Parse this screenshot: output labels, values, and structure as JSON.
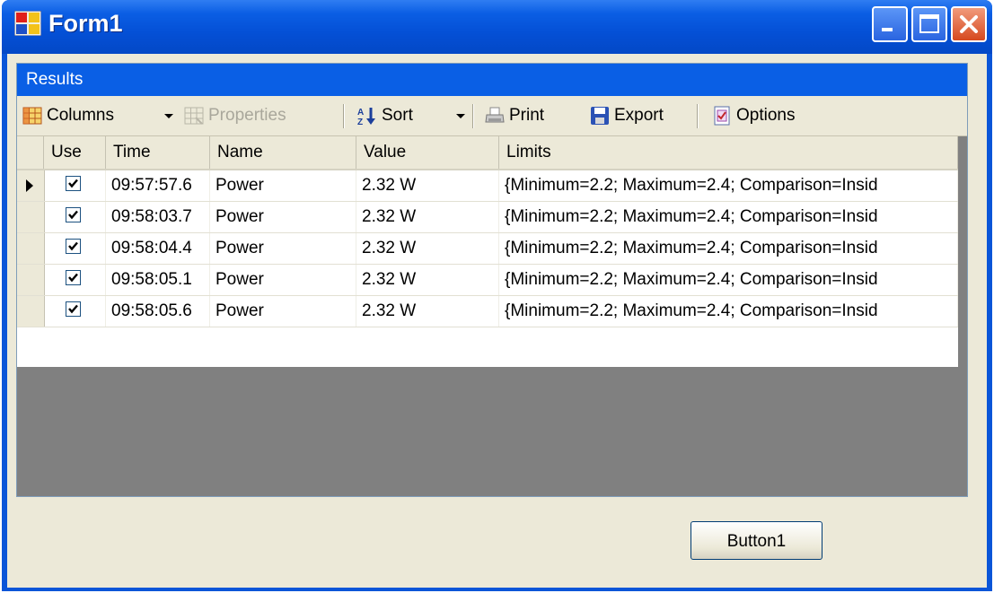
{
  "window": {
    "title": "Form1",
    "title_icon": "form-app-icon"
  },
  "titlebar_buttons": {
    "minimize": "minimize-icon",
    "maximize": "maximize-icon",
    "close": "close-icon"
  },
  "panel": {
    "header": "Results"
  },
  "toolbar": {
    "columns_label": "Columns",
    "properties_label": "Properties",
    "sort_label": "Sort",
    "print_label": "Print",
    "export_label": "Export",
    "options_label": "Options"
  },
  "grid": {
    "columns": [
      "Use",
      "Time",
      "Name",
      "Value",
      "Limits"
    ],
    "rows": [
      {
        "use": true,
        "time": "09:57:57.6",
        "name": "Power",
        "value": "2.32 W",
        "limits": "{Minimum=2.2; Maximum=2.4; Comparison=Insid",
        "current": true
      },
      {
        "use": true,
        "time": "09:58:03.7",
        "name": "Power",
        "value": "2.32 W",
        "limits": "{Minimum=2.2; Maximum=2.4; Comparison=Insid",
        "current": false
      },
      {
        "use": true,
        "time": "09:58:04.4",
        "name": "Power",
        "value": "2.32 W",
        "limits": "{Minimum=2.2; Maximum=2.4; Comparison=Insid",
        "current": false
      },
      {
        "use": true,
        "time": "09:58:05.1",
        "name": "Power",
        "value": "2.32 W",
        "limits": "{Minimum=2.2; Maximum=2.4; Comparison=Insid",
        "current": false
      },
      {
        "use": true,
        "time": "09:58:05.6",
        "name": "Power",
        "value": "2.32 W",
        "limits": "{Minimum=2.2; Maximum=2.4; Comparison=Insid",
        "current": false
      }
    ]
  },
  "button1_label": "Button1",
  "colors": {
    "title_blue": "#0a55d8",
    "header_blue": "#0a5fe5",
    "face": "#ece9d8",
    "grid_empty": "#808080"
  }
}
